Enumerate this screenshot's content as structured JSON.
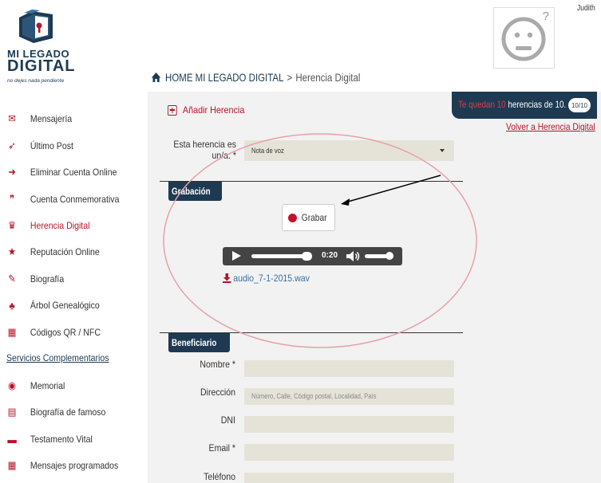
{
  "logo": {
    "line1": "MI LEGADO",
    "line2": "DIGITAL",
    "tagline": "no dejes nada pendiente"
  },
  "sidebar": {
    "items": [
      {
        "label": "Mensajería",
        "icon": "envelope-icon"
      },
      {
        "label": "Último Post",
        "icon": "paper-plane-icon"
      },
      {
        "label": "Eliminar Cuenta Online",
        "icon": "sign-out-icon"
      },
      {
        "label": "Cuenta Conmemorativa",
        "icon": "quote-icon"
      },
      {
        "label": "Herencia Digital",
        "icon": "gift-icon",
        "active": true
      },
      {
        "label": "Reputación Online",
        "icon": "star-icon"
      },
      {
        "label": "Biografía",
        "icon": "edit-icon"
      },
      {
        "label": "Árbol Genealógico",
        "icon": "tree-icon"
      },
      {
        "label": "Códigos QR / NFC",
        "icon": "qrcode-icon"
      }
    ],
    "section_title": "Servicios Complementarios",
    "extra_items": [
      {
        "label": "Memorial",
        "icon": "camera-icon"
      },
      {
        "label": "Biografía de famoso",
        "icon": "newspaper-icon"
      },
      {
        "label": "Testamento Vital",
        "icon": "briefcase-icon"
      },
      {
        "label": "Mensajes programados",
        "icon": "calendar-icon"
      }
    ]
  },
  "header": {
    "user_name": "Judith",
    "avatar_hint": "?"
  },
  "breadcrumb": {
    "home": "HOME MI LEGADO DIGITAL",
    "separator": ">",
    "current": "Herencia Digital"
  },
  "quota": {
    "prefix": "Te quedan ",
    "count": "10",
    "suffix": " herencias de 10.",
    "badge": "10/10"
  },
  "actions": {
    "add_label": "Añadir Herencia",
    "back_label": "Volver a Herencia Digital"
  },
  "form": {
    "type_label": "Esta herencia es un/a: *",
    "type_value": "Nota de voz",
    "recording_title": "Grabación",
    "record_button": "Grabar",
    "player": {
      "time": "0:20",
      "progress": 0.92,
      "volume": 0.85
    },
    "file_name": "audio_7-1-2015.wav",
    "beneficiary_title": "Beneficiario",
    "fields": [
      {
        "label": "Nombre *",
        "placeholder": ""
      },
      {
        "label": "Dirección",
        "placeholder": "Número, Calle, Código postal, Localidad, País"
      },
      {
        "label": "DNI",
        "placeholder": ""
      },
      {
        "label": "Email *",
        "placeholder": ""
      },
      {
        "label": "Teléfono",
        "placeholder": ""
      }
    ]
  },
  "colors": {
    "brand_navy": "#1d3a52",
    "accent_red": "#b5152b",
    "panel_bg": "#f2f2f2",
    "input_bg": "#e5e3d8",
    "annotation": "#e8a0a8"
  }
}
